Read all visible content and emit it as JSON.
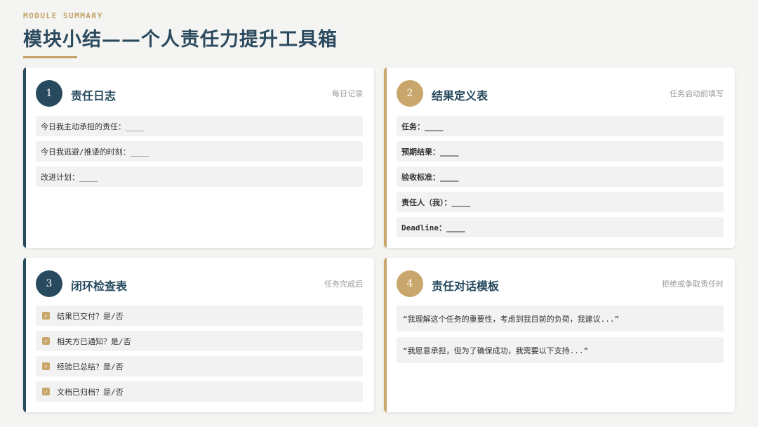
{
  "header": {
    "eyebrow": "MODULE SUMMARY",
    "title": "模块小结——个人责任力提升工具箱"
  },
  "cards": [
    {
      "number": "1",
      "title": "责任日志",
      "note": "每日记录",
      "rows": [
        "今日我主动承担的责任：____",
        "今日我逃避/推诿的时刻：____",
        "改进计划：____"
      ]
    },
    {
      "number": "2",
      "title": "结果定义表",
      "note": "任务启动前填写",
      "rows": [
        "任务：____",
        "预期结果：____",
        "验收标准：____",
        "责任人（我）：____",
        "Deadline：____"
      ]
    },
    {
      "number": "3",
      "title": "闭环检查表",
      "note": "任务完成后",
      "rows": [
        "结果已交付？是/否",
        "相关方已通知？是/否",
        "经验已总结？是/否",
        "文档已归档？是/否"
      ]
    },
    {
      "number": "4",
      "title": "责任对话模板",
      "note": "拒绝或争取责任时",
      "rows": [
        "“我理解这个任务的重要性，考虑到我目前的负荷，我建议...”",
        "“我愿意承担，但为了确保成功，我需要以下支持...”"
      ]
    }
  ],
  "colors": {
    "navy": "#274a5e",
    "gold": "#c9a66b",
    "background": "#f4f4f2"
  },
  "icons": {
    "check": "checkmark-icon"
  }
}
